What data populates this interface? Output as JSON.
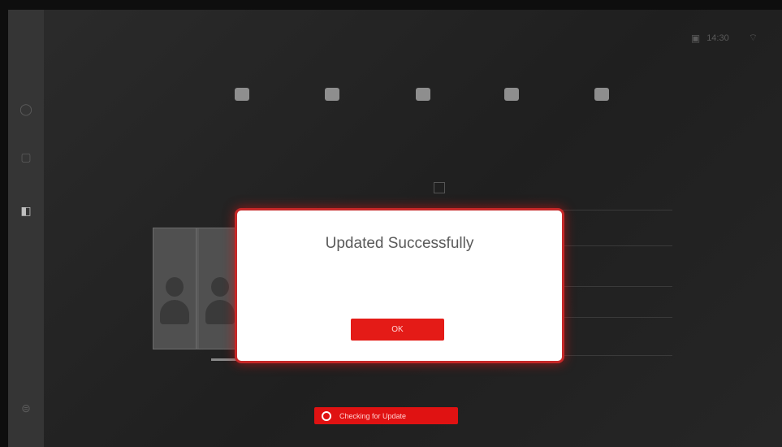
{
  "sidebar": {
    "items": [
      {
        "icon": "home-icon"
      },
      {
        "icon": "monitor-icon"
      },
      {
        "icon": "tablet-icon",
        "active": true
      },
      {
        "icon": "settings-icon"
      }
    ]
  },
  "status_bar": {
    "time": "14:30",
    "screen_icon": "screen-icon",
    "wifi_icon": "wifi-icon"
  },
  "top_tiles": [
    "tile-icon",
    "tile-icon",
    "tile-icon",
    "tile-icon",
    "tile-icon"
  ],
  "dialog": {
    "title": "Updated Successfully",
    "ok_label": "OK"
  },
  "update_status": {
    "label": "Checking for Update"
  },
  "colors": {
    "accent": "#e41b17",
    "dialog_border": "#c62828",
    "background": "#222222"
  }
}
